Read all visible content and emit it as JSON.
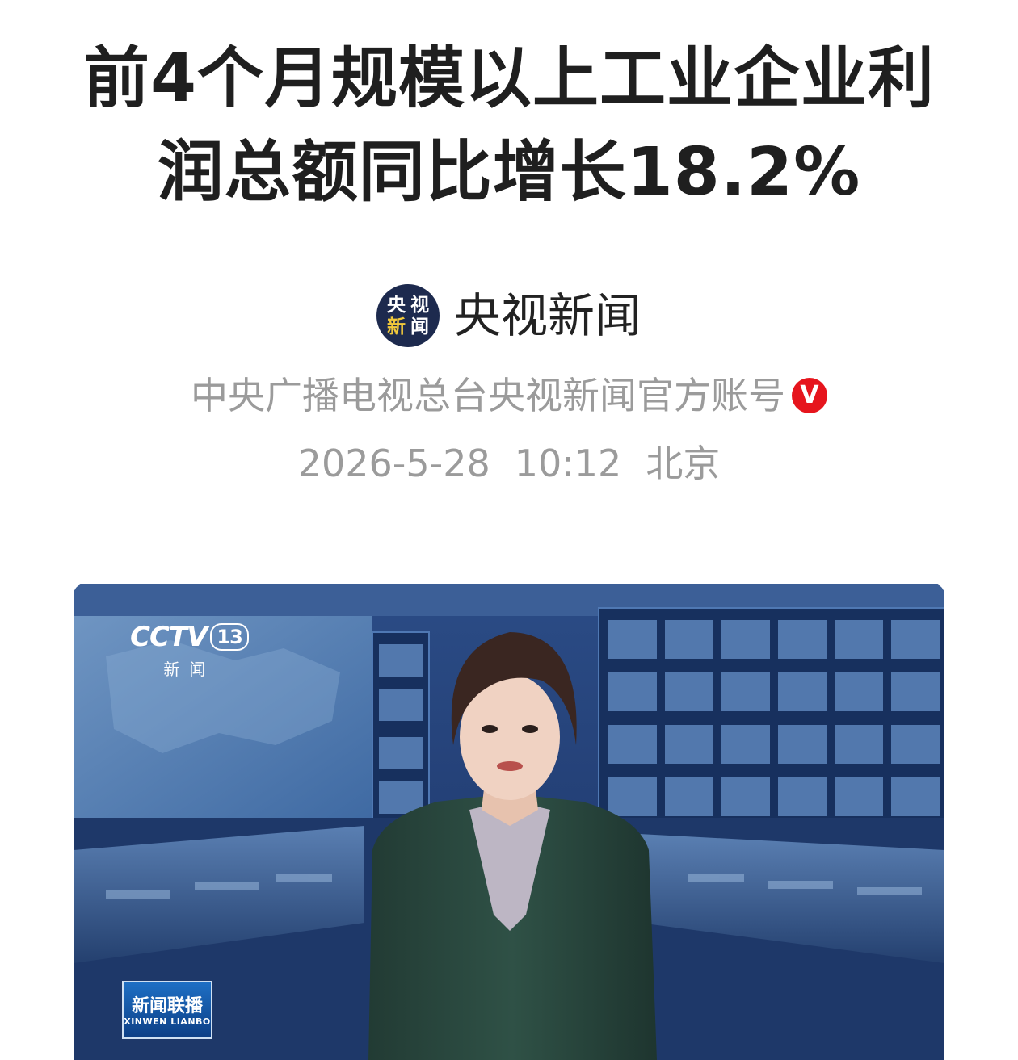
{
  "article": {
    "title_line1": "前4个月规模以上工业企业利",
    "title_line2": "润总额同比增长18.2%"
  },
  "source": {
    "avatar_chars": [
      "央",
      "视",
      "新",
      "闻"
    ],
    "name": "央视新闻",
    "description": "中央广播电视总台央视新闻官方账号",
    "verified_badge": "V"
  },
  "meta": {
    "date": "2026-5-28",
    "time": "10:12",
    "location": "北京"
  },
  "video": {
    "channel_logo": "CCTV",
    "channel_number": "13",
    "channel_sub": "新闻",
    "show_logo_zh": "新闻联播",
    "show_logo_en": "XINWEN LIANBO"
  },
  "colors": {
    "title": "#1f1f1f",
    "meta_gray": "#9b9b9b",
    "verified_red": "#e6151d",
    "avatar_navy": "#1d2a4e",
    "avatar_yellow": "#f1c93b"
  }
}
